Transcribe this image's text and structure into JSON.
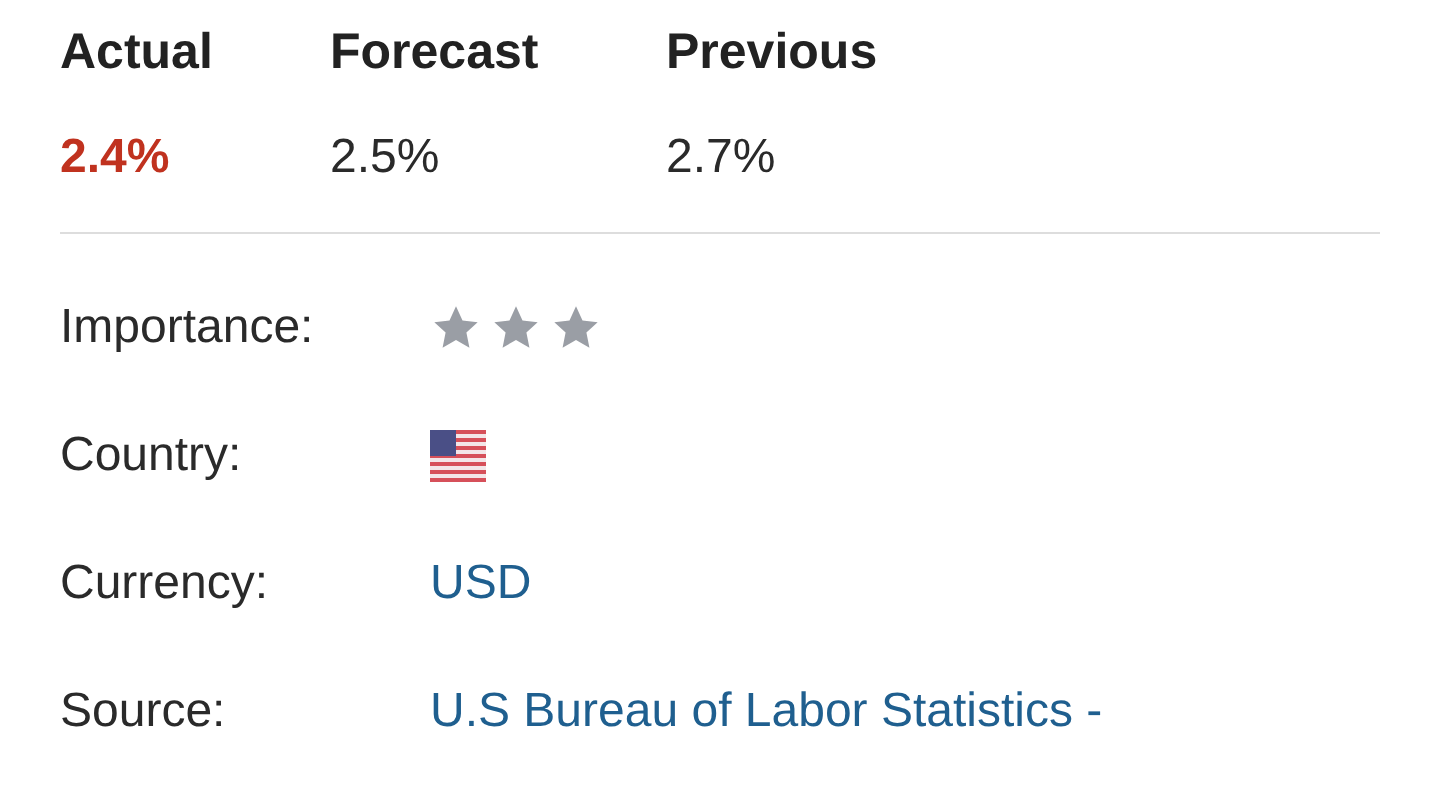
{
  "stats": [
    {
      "label": "Actual",
      "value": "2.4%",
      "color": "#c0321f"
    },
    {
      "label": "Forecast",
      "value": "2.5%",
      "color": "#2a2a2a"
    },
    {
      "label": "Previous",
      "value": "2.7%",
      "color": "#2a2a2a"
    }
  ],
  "details": [
    {
      "kind": "stars",
      "label": "Importance:",
      "stars": 3
    },
    {
      "kind": "flag",
      "label": "Country:"
    },
    {
      "kind": "link",
      "label": "Currency:",
      "value": "USD"
    },
    {
      "kind": "link",
      "label": "Source:",
      "value": "U.S Bureau of Labor Statistics -"
    }
  ]
}
